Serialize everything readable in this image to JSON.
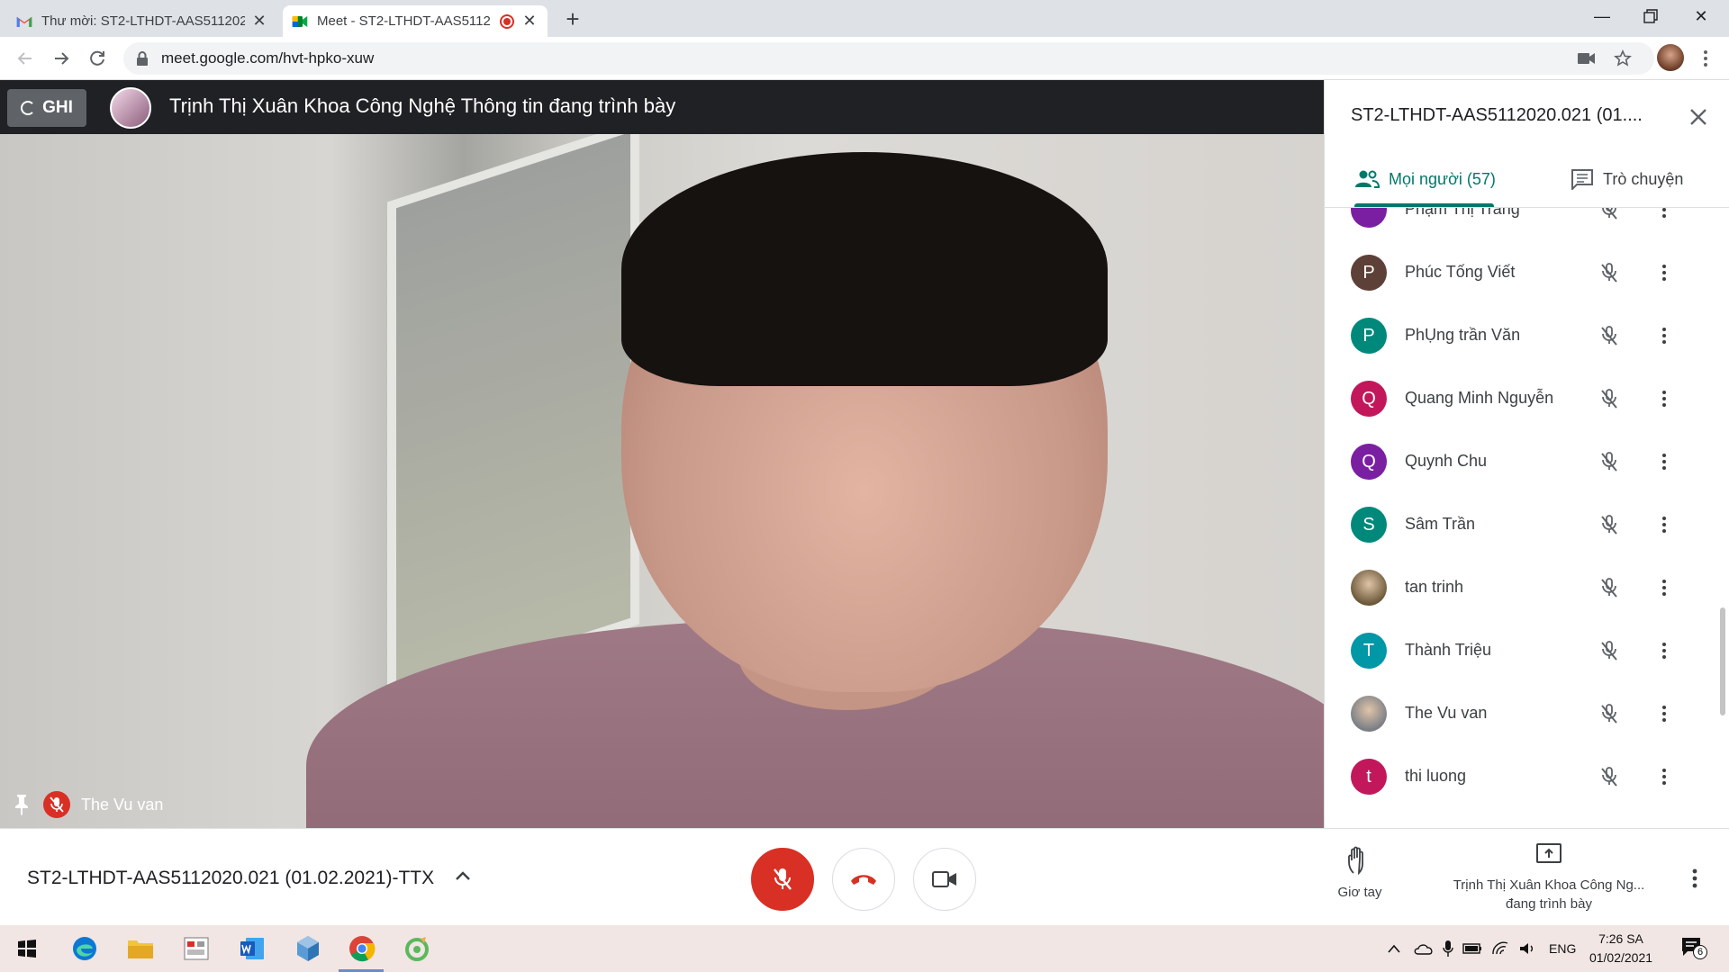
{
  "browser": {
    "tabs": [
      {
        "title": "Thư mời: ST2-LTHDT-AAS511202",
        "active": false
      },
      {
        "title": "Meet - ST2-LTHDT-AAS5112",
        "active": true
      }
    ],
    "url": "meet.google.com/hvt-hpko-xuw"
  },
  "presenter_bar": {
    "record_label": "GHI",
    "presenting_text": "Trịnh Thị Xuân Khoa Công Nghệ Thông tin đang trình bày"
  },
  "video": {
    "participant_name": "The Vu van"
  },
  "controls": {
    "meeting_title": "ST2-LTHDT-AAS5112020.021 (01.02.2021)-TTX",
    "raise_hand_label": "Giơ tay",
    "presenting_label": "Trịnh Thị Xuân Khoa Công Ng...\nđang trình bày"
  },
  "panel": {
    "title": "ST2-LTHDT-AAS5112020.021 (01....",
    "people_tab": "Mọi người (57)",
    "chat_tab": "Trò chuyện",
    "participants": [
      {
        "name": "Phạm Thị Trang",
        "initial": "",
        "color": "#7b1fa2",
        "photo": false
      },
      {
        "name": "Phúc Tống Viết",
        "initial": "P",
        "color": "#5d4037",
        "photo": false
      },
      {
        "name": "PhỤng trần Văn",
        "initial": "P",
        "color": "#00897b",
        "photo": false
      },
      {
        "name": "Quang Minh Nguyễn",
        "initial": "Q",
        "color": "#c2185b",
        "photo": false
      },
      {
        "name": "Quynh Chu",
        "initial": "Q",
        "color": "#7b1fa2",
        "photo": false
      },
      {
        "name": "Sâm Trần",
        "initial": "S",
        "color": "#00897b",
        "photo": false
      },
      {
        "name": "tan trinh",
        "initial": "",
        "color": "#6d5a3a",
        "photo": true
      },
      {
        "name": "Thành Triệu",
        "initial": "T",
        "color": "#0097a7",
        "photo": false
      },
      {
        "name": "The Vu van",
        "initial": "",
        "color": "#7a7f86",
        "photo": true
      },
      {
        "name": "thi luong",
        "initial": "t",
        "color": "#c2185b",
        "photo": false
      }
    ]
  },
  "taskbar": {
    "apps": [
      "start-icon",
      "edge-icon",
      "file-explorer-icon",
      "app-icon",
      "word-icon",
      "3d-viewer-icon",
      "chrome-icon",
      "coccoc-icon"
    ],
    "language": "ENG",
    "time": "7:26 SA",
    "date": "01/02/2021",
    "notification_count": "6"
  }
}
